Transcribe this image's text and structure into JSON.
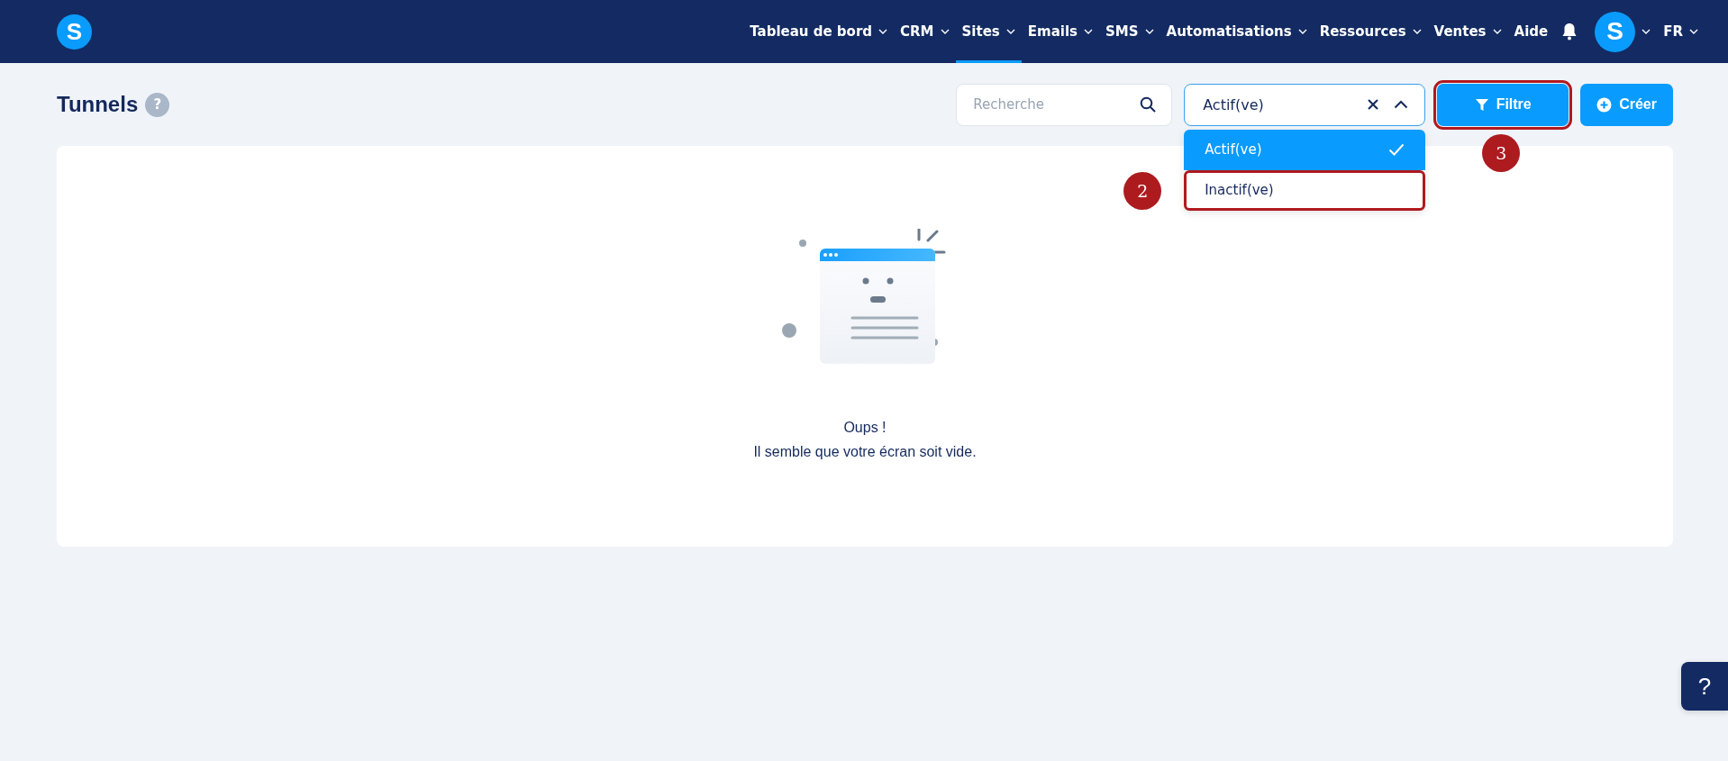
{
  "header": {
    "logo": "S",
    "nav": [
      {
        "label": "Tableau de bord",
        "caret": true,
        "selected": false
      },
      {
        "label": "CRM",
        "caret": true,
        "selected": false
      },
      {
        "label": "Sites",
        "caret": true,
        "selected": true
      },
      {
        "label": "Emails",
        "caret": true,
        "selected": false
      },
      {
        "label": "SMS",
        "caret": true,
        "selected": false
      },
      {
        "label": "Automatisations",
        "caret": true,
        "selected": false
      },
      {
        "label": "Ressources",
        "caret": true,
        "selected": false
      },
      {
        "label": "Ventes",
        "caret": true,
        "selected": false
      },
      {
        "label": "Aide",
        "caret": false,
        "selected": false
      }
    ],
    "avatar": "S",
    "language": "FR"
  },
  "page": {
    "title": "Tunnels",
    "help": "?",
    "search": {
      "placeholder": "Recherche"
    },
    "status_select": {
      "value": "Actif(ve)",
      "expanded": true,
      "options": [
        {
          "label": "Actif(ve)",
          "selected": true,
          "highlighted": false
        },
        {
          "label": "Inactif(ve)",
          "selected": false,
          "highlighted": true,
          "annotation": "2"
        }
      ]
    },
    "filter_button": {
      "label": "Filtre",
      "highlighted": true,
      "annotation": "3"
    },
    "create_button": {
      "label": "Créer"
    }
  },
  "empty_state": {
    "title": "Oups !",
    "message": "Il semble que votre écran soit vide."
  },
  "help_button": "?"
}
